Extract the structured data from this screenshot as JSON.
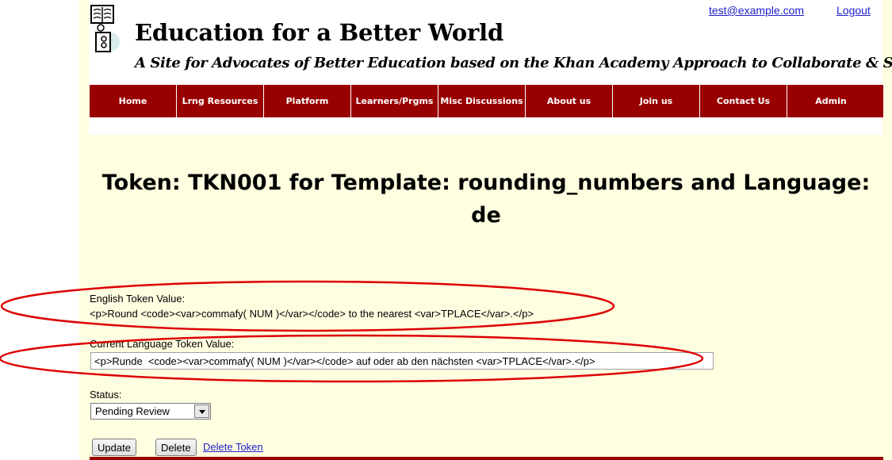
{
  "header": {
    "title": "Education for a Better World",
    "tagline": "A Site for Advocates of Better Education based on the Khan Academy Approach to Collaborate & Share",
    "user_email": "test@example.com",
    "logout_label": "Logout"
  },
  "nav": {
    "items": [
      {
        "label": "Home"
      },
      {
        "label": "Lrng Resources"
      },
      {
        "label": "Platform"
      },
      {
        "label": "Learners/Prgms"
      },
      {
        "label": "Misc Discussions"
      },
      {
        "label": "About us"
      },
      {
        "label": "Join us"
      },
      {
        "label": "Contact Us"
      },
      {
        "label": "Admin"
      }
    ]
  },
  "page": {
    "heading_line1": "Token: TKN001 for Template: rounding_numbers and Language:",
    "heading_line2": "de"
  },
  "form": {
    "english_label": "English Token Value:",
    "english_value": "<p>Round <code><var>commafy( NUM )</var></code> to the nearest <var>TPLACE</var>.</p>",
    "current_label": "Current Language Token Value:",
    "current_value": "<p>Runde  <code><var>commafy( NUM )</var></code> auf oder ab den nächsten <var>TPLACE</var>.</p>",
    "status_label": "Status:",
    "status_selected": "Pending Review",
    "update_label": "Update",
    "delete_label": "Delete",
    "delete_token_link": "Delete Token"
  },
  "colors": {
    "nav_bg": "#990000",
    "page_bg": "#fefee0",
    "annotation": "#dd0000",
    "link": "#2020cc"
  }
}
